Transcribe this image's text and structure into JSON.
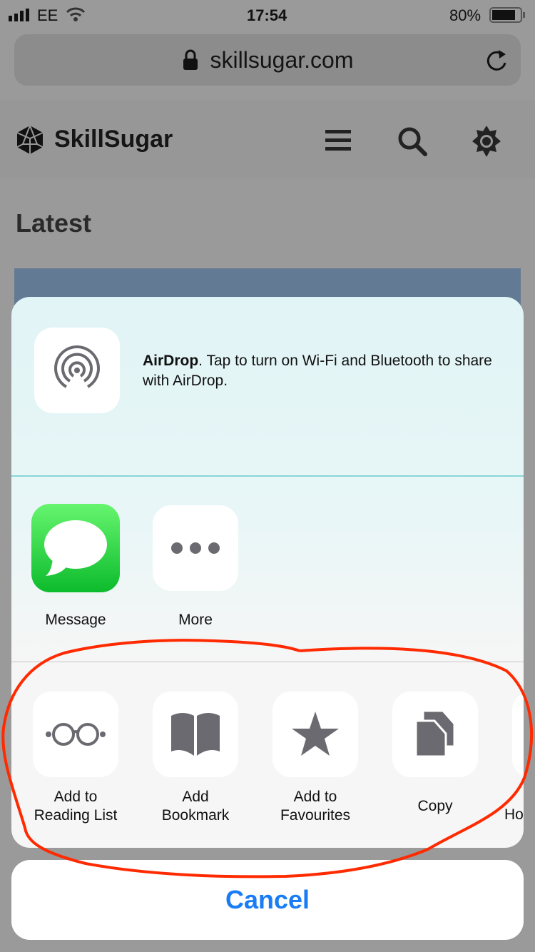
{
  "status_bar": {
    "carrier": "EE",
    "time": "17:54",
    "battery": "80%"
  },
  "browser": {
    "url": "skillsugar.com"
  },
  "site": {
    "brand": "SkillSugar",
    "section_title": "Latest"
  },
  "share_sheet": {
    "airdrop": {
      "title": "AirDrop",
      "text": ". Tap to turn on Wi-Fi and Bluetooth to share with AirDrop."
    },
    "apps": [
      {
        "label": "Message",
        "icon": "message-icon"
      },
      {
        "label": "More",
        "icon": "more-icon"
      }
    ],
    "actions": [
      {
        "line1": "Add to",
        "line2": "Reading List",
        "icon": "glasses-icon"
      },
      {
        "line1": "Add",
        "line2": "Bookmark",
        "icon": "book-icon"
      },
      {
        "line1": "Add to",
        "line2": "Favourites",
        "icon": "star-icon"
      },
      {
        "line1": "",
        "line2": "Copy",
        "icon": "copy-icon"
      },
      {
        "line1": "",
        "line2": "Ho",
        "icon": "partial-icon"
      }
    ],
    "cancel_label": "Cancel"
  },
  "colors": {
    "accent": "#1a7cf5",
    "annotation": "#ff2a00",
    "message_green": "#2fd348"
  }
}
